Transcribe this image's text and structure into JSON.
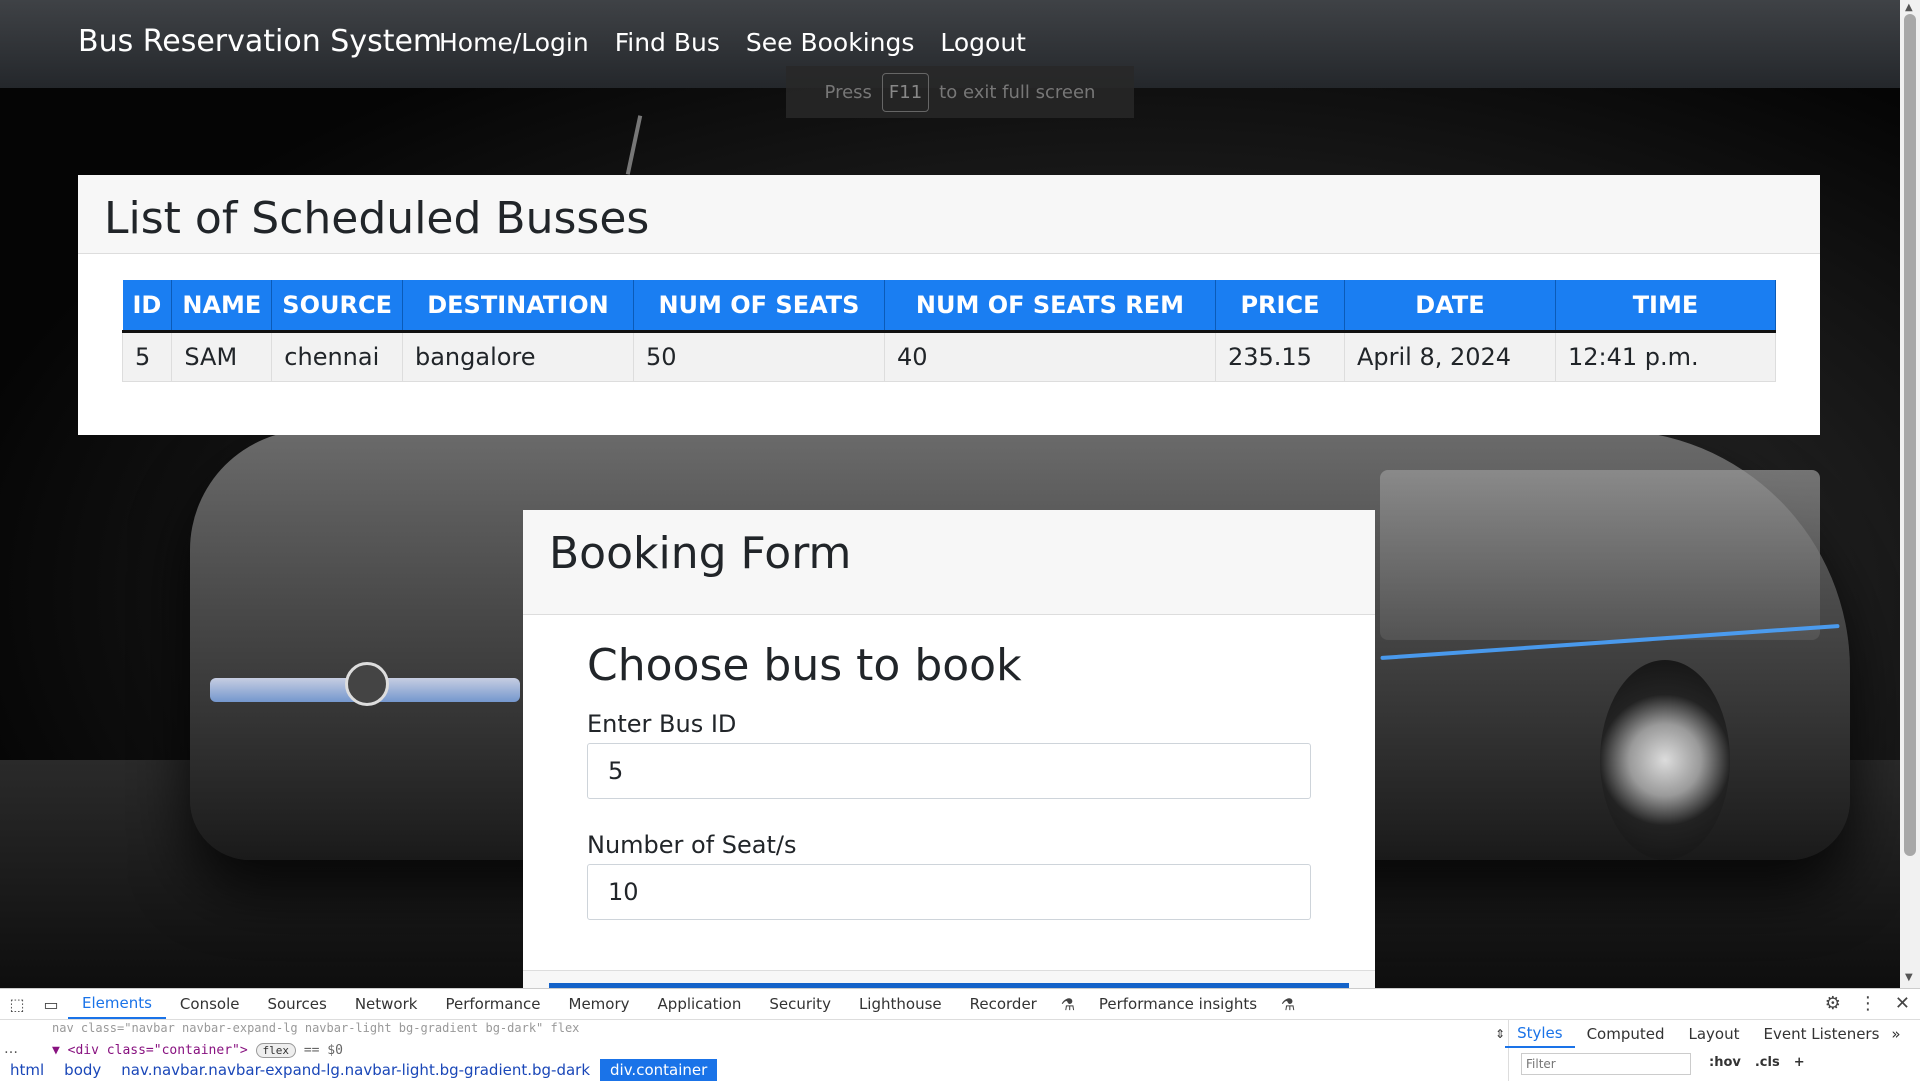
{
  "navbar": {
    "brand": "Bus Reservation System",
    "links": [
      "Home/Login",
      "Find Bus",
      "See Bookings",
      "Logout"
    ]
  },
  "fullscreen_hint": {
    "press": "Press",
    "key": "F11",
    "rest": "to exit full screen"
  },
  "schedule": {
    "title": "List of Scheduled Busses",
    "columns": [
      "ID",
      "NAME",
      "SOURCE",
      "DESTINATION",
      "NUM OF SEATS",
      "NUM OF SEATS REM",
      "PRICE",
      "DATE",
      "TIME"
    ],
    "rows": [
      [
        "5",
        "SAM",
        "chennai",
        "bangalore",
        "50",
        "40",
        "235.15",
        "April 8, 2024",
        "12:41 p.m."
      ]
    ]
  },
  "booking": {
    "title": "Booking Form",
    "subtitle": "Choose bus to book",
    "bus_id_label": "Enter Bus ID",
    "bus_id_value": "5",
    "seats_label": "Number of Seat/s",
    "seats_value": "10"
  },
  "devtools": {
    "tabs": [
      "Elements",
      "Console",
      "Sources",
      "Network",
      "Performance",
      "Memory",
      "Application",
      "Security",
      "Lighthouse",
      "Recorder",
      "Performance insights"
    ],
    "active_tab": "Elements",
    "dom_line_faded": "nav class=\"navbar navbar-expand-lg navbar-light bg-gradient bg-dark\" flex",
    "dom_line_selected": "<div class=\"container\">",
    "dom_badge": "flex",
    "dom_eq": "== $0",
    "breadcrumbs": [
      "html",
      "body",
      "nav.navbar.navbar-expand-lg.navbar-light.bg-gradient.bg-dark",
      "div.container"
    ],
    "side_tabs": [
      "Styles",
      "Computed",
      "Layout",
      "Event Listeners"
    ],
    "filter_placeholder": "Filter",
    "tools": [
      ":hov",
      ".cls",
      "+"
    ]
  }
}
